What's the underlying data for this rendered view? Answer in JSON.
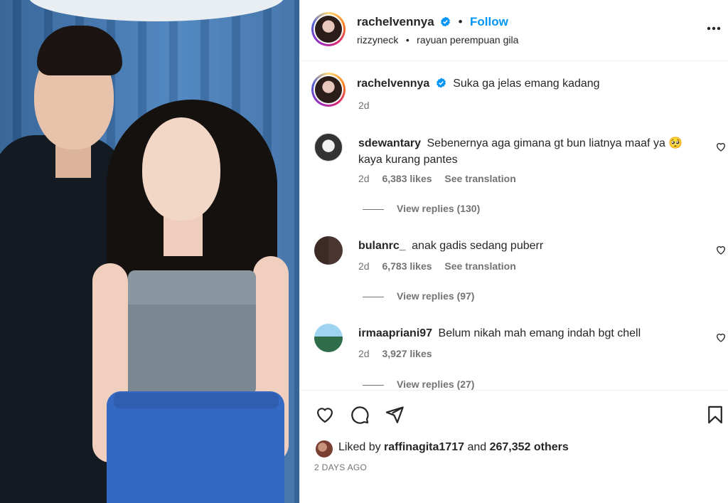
{
  "post": {
    "username": "rachelvennya",
    "follow_label": "Follow",
    "audio_artist": "rizzyneck",
    "audio_separator": "•",
    "audio_title": "rayuan perempuan gila",
    "more_icon": "more-horizontal-icon"
  },
  "caption": {
    "username": "rachelvennya",
    "text": "Suka ga jelas emang kadang",
    "time": "2d"
  },
  "comments": [
    {
      "username": "sdewantary",
      "text": "Sebenernya aga gimana gt bun liatnya maaf ya 🥺",
      "text2": "kaya kurang pantes",
      "time": "2d",
      "likes": "6,383 likes",
      "translate": "See translation",
      "replies": "View replies (130)"
    },
    {
      "username": "bulanrc_",
      "text": "anak gadis sedang puberr",
      "time": "2d",
      "likes": "6,783 likes",
      "translate": "See translation",
      "replies": "View replies (97)"
    },
    {
      "username": "irmaapriani97",
      "text": "Belum nikah mah emang indah bgt chell",
      "time": "2d",
      "likes": "3,927 likes",
      "replies": "View replies (27)"
    }
  ],
  "likes": {
    "prefix": "Liked by",
    "user": "raffinagita1717",
    "mid": "and",
    "count": "267,352 others"
  },
  "timestamp": "2 DAYS AGO",
  "colors": {
    "accent": "#0095f6",
    "text": "#262626",
    "muted": "#737373",
    "verified": "#0095f6"
  }
}
